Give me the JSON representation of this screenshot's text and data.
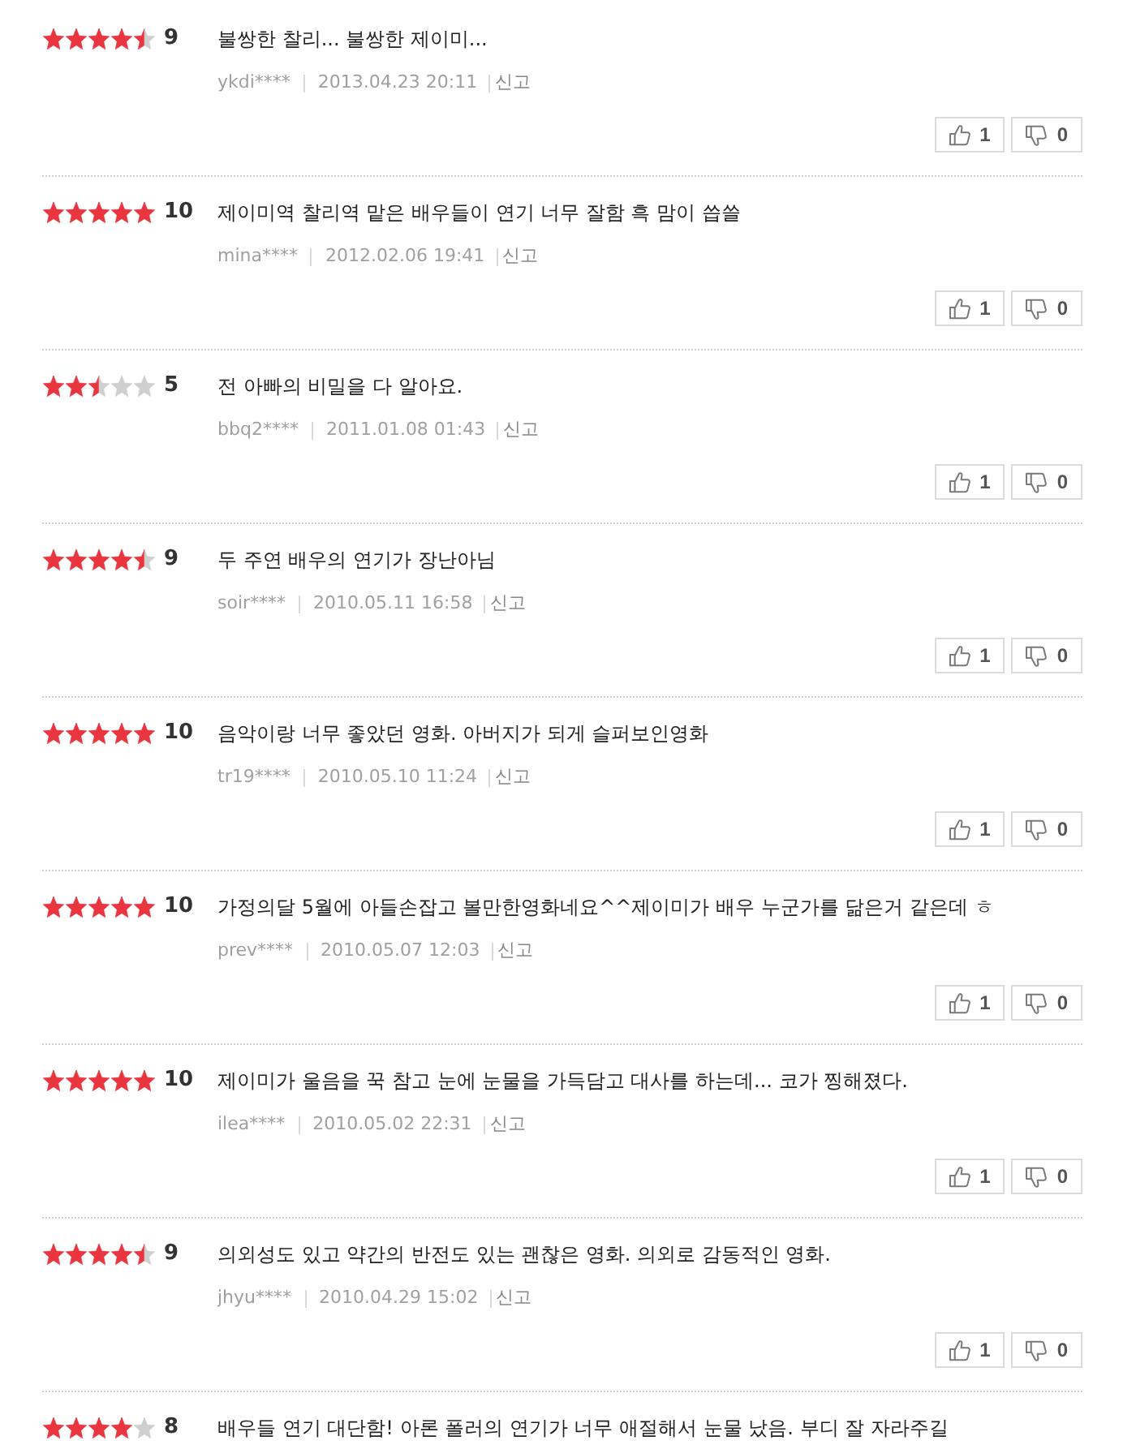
{
  "reviews": [
    {
      "stars": 4.5,
      "score": "9",
      "text": "불쌍한 찰리... 불쌍한 제이미...",
      "user": "ykdi****",
      "date": "2013.04.23 20:11",
      "report": "신고",
      "likes": "1",
      "dislikes": "0"
    },
    {
      "stars": 5,
      "score": "10",
      "text": "제이미역 찰리역 맡은 배우들이 연기 너무 잘함 흑 맘이 씁쓸",
      "user": "mina****",
      "date": "2012.02.06 19:41",
      "report": "신고",
      "likes": "1",
      "dislikes": "0"
    },
    {
      "stars": 2.5,
      "score": "5",
      "text": "전 아빠의 비밀을 다 알아요.",
      "user": "bbq2****",
      "date": "2011.01.08 01:43",
      "report": "신고",
      "likes": "1",
      "dislikes": "0"
    },
    {
      "stars": 4.5,
      "score": "9",
      "text": "두 주연 배우의 연기가 장난아님",
      "user": "soir****",
      "date": "2010.05.11 16:58",
      "report": "신고",
      "likes": "1",
      "dislikes": "0"
    },
    {
      "stars": 5,
      "score": "10",
      "text": "음악이랑 너무 좋았던 영화. 아버지가 되게 슬퍼보인영화",
      "user": "tr19****",
      "date": "2010.05.10 11:24",
      "report": "신고",
      "likes": "1",
      "dislikes": "0"
    },
    {
      "stars": 5,
      "score": "10",
      "text": "가정의달 5월에 아들손잡고 볼만한영화네요^^제이미가 배우 누군가를 닮은거 같은데 ㅎ",
      "user": "prev****",
      "date": "2010.05.07 12:03",
      "report": "신고",
      "likes": "1",
      "dislikes": "0"
    },
    {
      "stars": 5,
      "score": "10",
      "text": "제이미가 울음을 꾹 참고 눈에 눈물을 가득담고 대사를 하는데... 코가 찡해졌다.",
      "user": "ilea****",
      "date": "2010.05.02 22:31",
      "report": "신고",
      "likes": "1",
      "dislikes": "0"
    },
    {
      "stars": 4.5,
      "score": "9",
      "text": "의외성도 있고 약간의 반전도 있는 괜찮은 영화. 의외로 감동적인 영화.",
      "user": "jhyu****",
      "date": "2010.04.29 15:02",
      "report": "신고",
      "likes": "1",
      "dislikes": "0"
    },
    {
      "stars": 4,
      "score": "8",
      "text": "배우들 연기 대단함! 아론 폴러의 연기가 너무 애절해서 눈물 났음. 부디 잘 자라주길"
    }
  ]
}
